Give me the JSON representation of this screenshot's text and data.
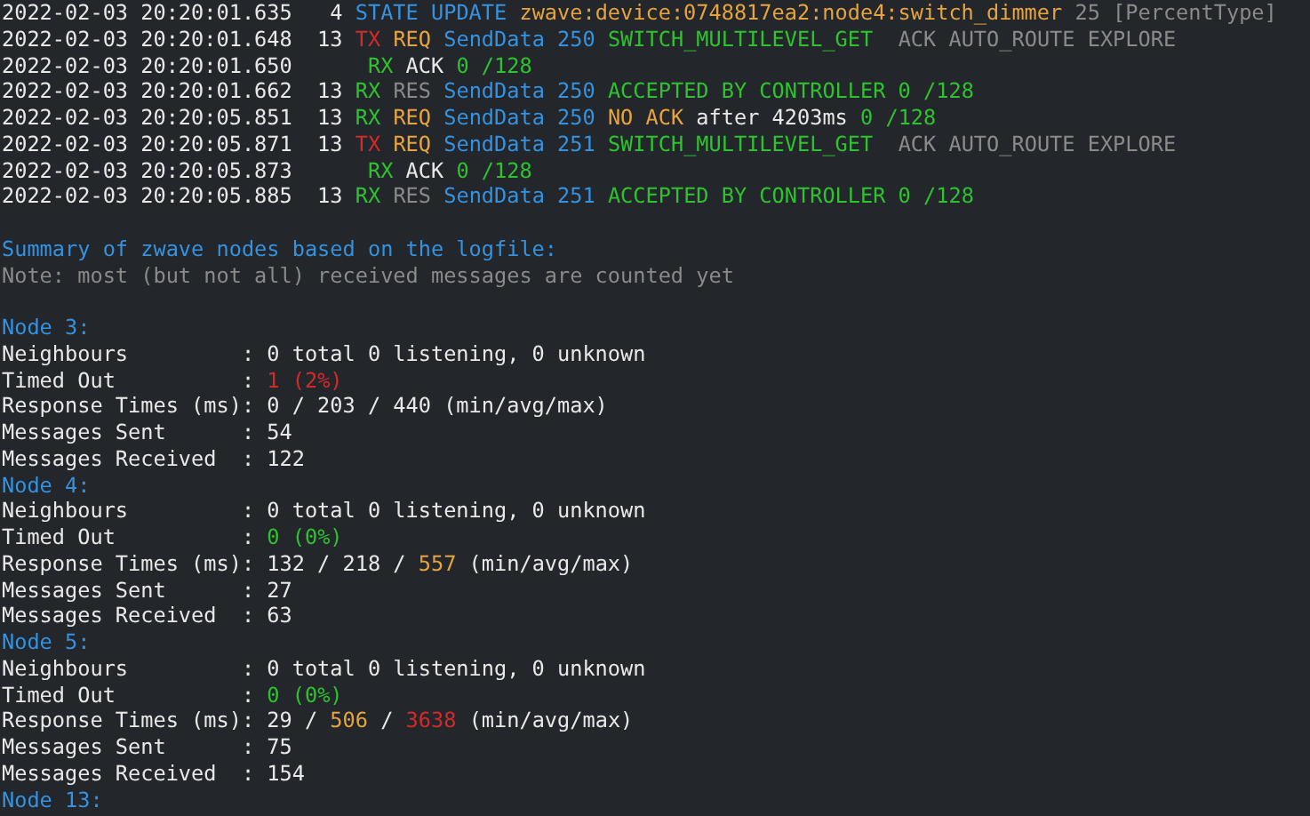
{
  "terminal": {
    "log": [
      {
        "segments": [
          {
            "text": "2022-02-03 20:20:01.635   4 ",
            "color": "#e8e8e8"
          },
          {
            "text": "STATE UPDATE ",
            "color": "#3592e0"
          },
          {
            "text": "zwave:device:0748817ea2:node4:switch_dimmer ",
            "color": "#e6a33e"
          },
          {
            "text": "25 [PercentType]",
            "color": "#8a8a8a"
          }
        ]
      },
      {
        "segments": [
          {
            "text": "2022-02-03 20:20:01.648  13 ",
            "color": "#e8e8e8"
          },
          {
            "text": "TX ",
            "color": "#d42a2a"
          },
          {
            "text": "REQ ",
            "color": "#e6a33e"
          },
          {
            "text": "SendData 250 ",
            "color": "#3592e0"
          },
          {
            "text": "SWITCH_MULTILEVEL_GET ",
            "color": "#2fc22f"
          },
          {
            "text": " ACK AUTO_ROUTE EXPLORE",
            "color": "#8a8a8a"
          }
        ]
      },
      {
        "segments": [
          {
            "text": "2022-02-03 20:20:01.650      ",
            "color": "#e8e8e8"
          },
          {
            "text": "RX ",
            "color": "#2fc22f"
          },
          {
            "text": "ACK ",
            "color": "#e8e8e8"
          },
          {
            "text": "0 /128",
            "color": "#2fc22f"
          }
        ]
      },
      {
        "segments": [
          {
            "text": "2022-02-03 20:20:01.662  13 ",
            "color": "#e8e8e8"
          },
          {
            "text": "RX ",
            "color": "#2fc22f"
          },
          {
            "text": "RES ",
            "color": "#8a8a8a"
          },
          {
            "text": "SendData 250 ",
            "color": "#3592e0"
          },
          {
            "text": "ACCEPTED BY CONTROLLER 0 /128",
            "color": "#2fc22f"
          }
        ]
      },
      {
        "segments": [
          {
            "text": "2022-02-03 20:20:05.851  13 ",
            "color": "#e8e8e8"
          },
          {
            "text": "RX ",
            "color": "#2fc22f"
          },
          {
            "text": "REQ ",
            "color": "#e6a33e"
          },
          {
            "text": "SendData 250 ",
            "color": "#3592e0"
          },
          {
            "text": "NO ACK ",
            "color": "#e6a33e"
          },
          {
            "text": "after 4203ms ",
            "color": "#e8e8e8"
          },
          {
            "text": "0 /128",
            "color": "#2fc22f"
          }
        ]
      },
      {
        "segments": [
          {
            "text": "2022-02-03 20:20:05.871  13 ",
            "color": "#e8e8e8"
          },
          {
            "text": "TX ",
            "color": "#d42a2a"
          },
          {
            "text": "REQ ",
            "color": "#e6a33e"
          },
          {
            "text": "SendData 251 ",
            "color": "#3592e0"
          },
          {
            "text": "SWITCH_MULTILEVEL_GET ",
            "color": "#2fc22f"
          },
          {
            "text": " ACK AUTO_ROUTE EXPLORE",
            "color": "#8a8a8a"
          }
        ]
      },
      {
        "segments": [
          {
            "text": "2022-02-03 20:20:05.873      ",
            "color": "#e8e8e8"
          },
          {
            "text": "RX ",
            "color": "#2fc22f"
          },
          {
            "text": "ACK ",
            "color": "#e8e8e8"
          },
          {
            "text": "0 /128",
            "color": "#2fc22f"
          }
        ]
      },
      {
        "segments": [
          {
            "text": "2022-02-03 20:20:05.885  13 ",
            "color": "#e8e8e8"
          },
          {
            "text": "RX ",
            "color": "#2fc22f"
          },
          {
            "text": "RES ",
            "color": "#8a8a8a"
          },
          {
            "text": "SendData 251 ",
            "color": "#3592e0"
          },
          {
            "text": "ACCEPTED BY CONTROLLER 0 /128",
            "color": "#2fc22f"
          }
        ]
      }
    ],
    "summary": [
      {
        "segments": [
          {
            "text": "Summary of zwave nodes based on the logfile:",
            "color": "#3592e0"
          }
        ]
      },
      {
        "segments": [
          {
            "text": "Note: most (but not all) received messages are counted yet",
            "color": "#8a8a8a"
          }
        ]
      }
    ],
    "nodes": [
      {
        "segments": [
          {
            "text": "Node 3:",
            "color": "#3592e0"
          }
        ]
      },
      {
        "segments": [
          {
            "text": "Neighbours         : 0 total 0 listening, 0 unknown",
            "color": "#e8e8e8"
          }
        ]
      },
      {
        "segments": [
          {
            "text": "Timed Out          : ",
            "color": "#e8e8e8"
          },
          {
            "text": "1 (2%)",
            "color": "#d42a2a"
          }
        ]
      },
      {
        "segments": [
          {
            "text": "Response Times (ms): 0 / 203 / 440 (min/avg/max)",
            "color": "#e8e8e8"
          }
        ]
      },
      {
        "segments": [
          {
            "text": "Messages Sent      : 54",
            "color": "#e8e8e8"
          }
        ]
      },
      {
        "segments": [
          {
            "text": "Messages Received  : 122",
            "color": "#e8e8e8"
          }
        ]
      },
      {
        "segments": [
          {
            "text": "Node 4:",
            "color": "#3592e0"
          }
        ]
      },
      {
        "segments": [
          {
            "text": "Neighbours         : 0 total 0 listening, 0 unknown",
            "color": "#e8e8e8"
          }
        ]
      },
      {
        "segments": [
          {
            "text": "Timed Out          : ",
            "color": "#e8e8e8"
          },
          {
            "text": "0 (0%)",
            "color": "#2fc22f"
          }
        ]
      },
      {
        "segments": [
          {
            "text": "Response Times (ms): 132 / 218 / ",
            "color": "#e8e8e8"
          },
          {
            "text": "557",
            "color": "#e6a33e"
          },
          {
            "text": " (min/avg/max)",
            "color": "#e8e8e8"
          }
        ]
      },
      {
        "segments": [
          {
            "text": "Messages Sent      : 27",
            "color": "#e8e8e8"
          }
        ]
      },
      {
        "segments": [
          {
            "text": "Messages Received  : 63",
            "color": "#e8e8e8"
          }
        ]
      },
      {
        "segments": [
          {
            "text": "Node 5:",
            "color": "#3592e0"
          }
        ]
      },
      {
        "segments": [
          {
            "text": "Neighbours         : 0 total 0 listening, 0 unknown",
            "color": "#e8e8e8"
          }
        ]
      },
      {
        "segments": [
          {
            "text": "Timed Out          : ",
            "color": "#e8e8e8"
          },
          {
            "text": "0 (0%)",
            "color": "#2fc22f"
          }
        ]
      },
      {
        "segments": [
          {
            "text": "Response Times (ms): 29 / ",
            "color": "#e8e8e8"
          },
          {
            "text": "506",
            "color": "#e6a33e"
          },
          {
            "text": " / ",
            "color": "#e8e8e8"
          },
          {
            "text": "3638",
            "color": "#d42a2a"
          },
          {
            "text": " (min/avg/max)",
            "color": "#e8e8e8"
          }
        ]
      },
      {
        "segments": [
          {
            "text": "Messages Sent      : 75",
            "color": "#e8e8e8"
          }
        ]
      },
      {
        "segments": [
          {
            "text": "Messages Received  : 154",
            "color": "#e8e8e8"
          }
        ]
      },
      {
        "segments": [
          {
            "text": "Node 13:",
            "color": "#3592e0"
          }
        ]
      }
    ]
  }
}
